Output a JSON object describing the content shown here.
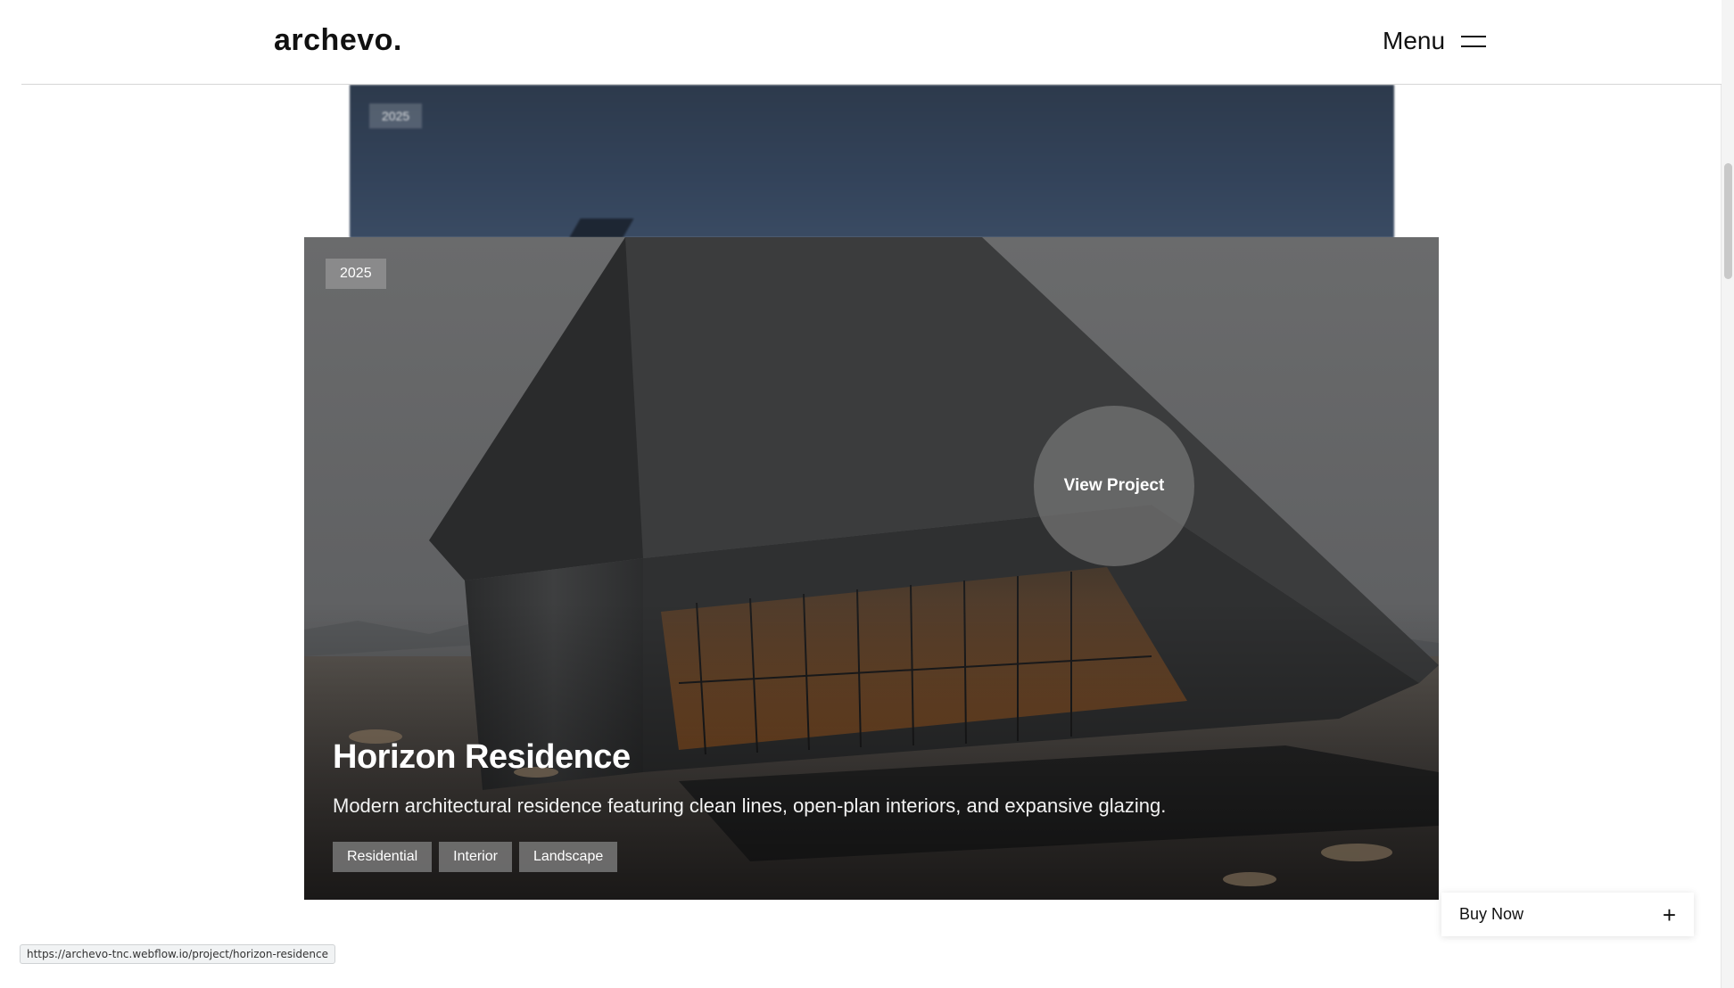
{
  "header": {
    "logo": "archevo.",
    "menu_label": "Menu",
    "menu_icon": "hamburger-icon"
  },
  "back_card": {
    "year": "2025"
  },
  "project": {
    "year": "2025",
    "view_label": "View Project",
    "title": "Horizon Residence",
    "description": "Modern architectural residence featuring clean lines, open-plan interiors, and expansive glazing.",
    "tags": [
      "Residential",
      "Interior",
      "Landscape"
    ]
  },
  "buy_now": {
    "label": "Buy Now",
    "icon": "plus-icon",
    "icon_glyph": "+"
  },
  "status_bar": {
    "url": "https://archevo-tnc.webflow.io/project/horizon-residence"
  }
}
